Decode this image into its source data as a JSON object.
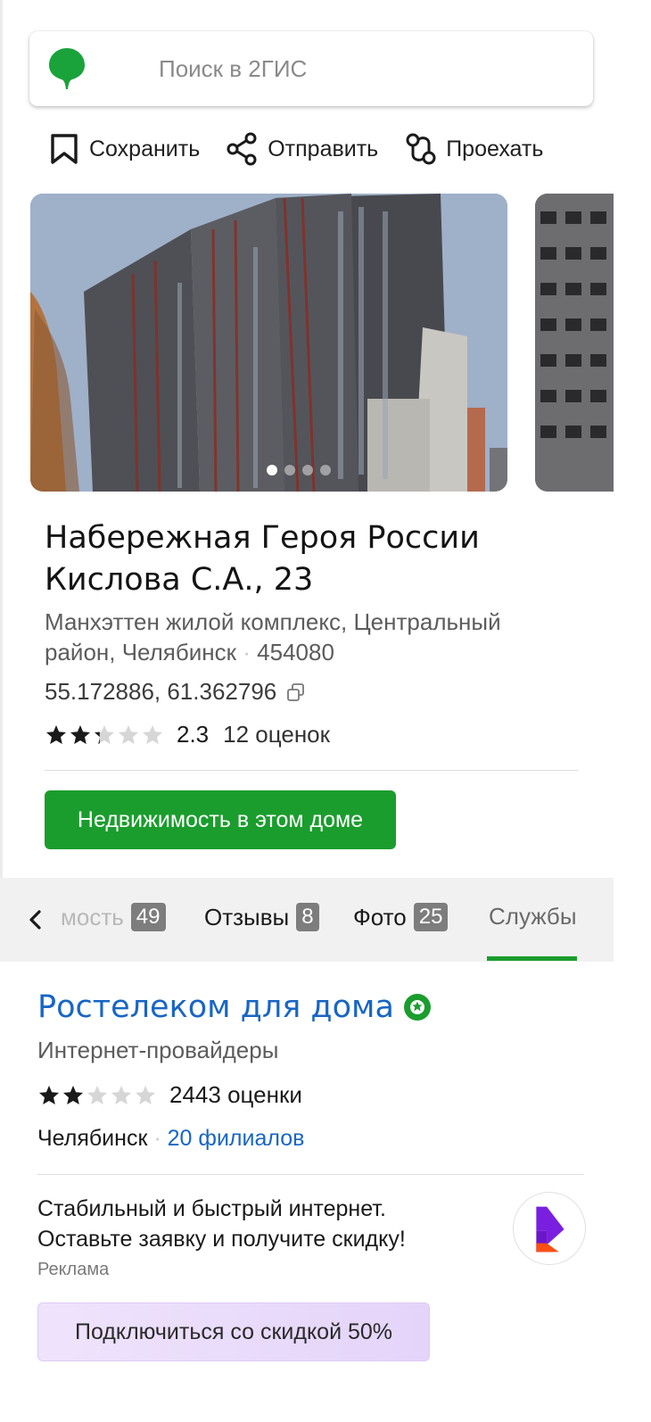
{
  "search": {
    "placeholder": "Поиск в 2ГИС"
  },
  "actions": [
    {
      "label": "Сохранить",
      "icon": "bookmark-icon"
    },
    {
      "label": "Отправить",
      "icon": "share-icon"
    },
    {
      "label": "Проехать",
      "icon": "route-icon"
    }
  ],
  "gallery": {
    "photo_count": 4,
    "active_index": 0
  },
  "place": {
    "title_line1": "Набережная Героя России",
    "title_line2": "Кислова С.А., 23",
    "address_line1": "Манхэттен жилой комплекс, Центральный",
    "address_line2": "район, Челябинск",
    "postcode": "454080",
    "coordinates": "55.172886, 61.362796",
    "rating": 2.3,
    "rating_text": "2.3",
    "reviews": "12 оценок",
    "primary_button": "Недвижимость в этом доме"
  },
  "tabs": [
    {
      "label": "мость",
      "badge": "49"
    },
    {
      "label": "Отзывы",
      "badge": "8"
    },
    {
      "label": "Фото",
      "badge": "25"
    },
    {
      "label": "Службы",
      "badge": ""
    }
  ],
  "advertiser": {
    "name": "Ростелеком для дома",
    "category": "Интернет-провайдеры",
    "rating": 2,
    "rating_text": "2",
    "reviews": "443 оценки",
    "city": "Челябинск",
    "branches": "20 филиалов",
    "text_line1": "Стабильный и быстрый интернет.",
    "text_line2": "Оставьте заявку и получите скидку!",
    "ad_label": "Реклама",
    "button": "Подключиться со скидкой 50%"
  },
  "colors": {
    "accent_green": "#1a9d2d",
    "link_blue": "#1866c4",
    "ad_button_bg": "#e9dcfb"
  }
}
